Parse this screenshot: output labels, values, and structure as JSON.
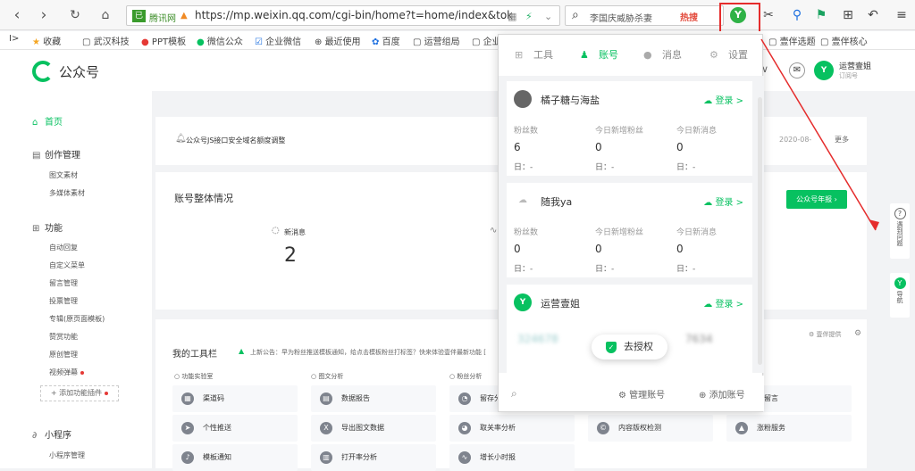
{
  "browser": {
    "site_badge": "已",
    "site_name": "腾讯网",
    "url": "https://mp.weixin.qq.com/cgi-bin/home?t=home/index&toke",
    "search_text": "李国庆威胁杀妻",
    "search_hot": "热搜",
    "ext_logo_letter": "Y"
  },
  "bookmarks": [
    "收藏",
    "武汉科技",
    "PPT模板",
    "微信公众",
    "企业微信",
    "最近使用",
    "百度",
    "运营组局",
    "企业",
    "壹伴选题",
    "壹伴核心"
  ],
  "topnav": {
    "logo_text": "公众号",
    "account_name": "运营壹姐",
    "account_sub": "订阅号",
    "avatar_letter": "Y"
  },
  "sidebar": {
    "home": "首页",
    "create": "创作管理",
    "create_items": [
      "图文素材",
      "多媒体素材"
    ],
    "func": "功能",
    "func_items": [
      "自动回复",
      "自定义菜单",
      "留言管理",
      "投票管理",
      "专辑(原页面模板)",
      "赞赏功能",
      "原创管理",
      "视频弹幕"
    ],
    "add_plugin": "+ 添加功能插件",
    "mini": "小程序",
    "mini_items": [
      "小程序管理"
    ]
  },
  "main": {
    "notice": "公众号JS接口安全域名额度调整",
    "notice_date": "2020-08-",
    "notice_more": "更多",
    "overview_title": "账号整体情况",
    "report_btn": "公众号年报",
    "metric_label": "新消息",
    "metric_value": "2",
    "toolbar_title": "我的工具栏",
    "toolbar_notice": "上新公告：早为粉丝推送模板通知，给点击模板粉丝打标签？快来体验壹伴最新功能 [",
    "brand_tag": "壹伴提供",
    "categories": [
      "功能实验室",
      "图文分析",
      "粉丝分析"
    ],
    "tools": [
      "渠道码",
      "数据报告",
      "留存分析",
      "个性推送",
      "导出图文数据",
      "取关率分析",
      "内容版权检测",
      "涨粉服务",
      "模板通知",
      "打开率分析",
      "增长小时报",
      "增留言"
    ]
  },
  "side_float": [
    {
      "icon": "?",
      "label": "遇到问题"
    },
    {
      "icon": "Y",
      "label": "导航"
    }
  ],
  "popup": {
    "tabs": [
      "工具",
      "账号",
      "消息",
      "设置"
    ],
    "active_tab": "账号",
    "login_label": "登录 >",
    "stat_labels": [
      "粉丝数",
      "今日新增粉丝",
      "今日新消息"
    ],
    "day_label": "日：-",
    "accounts": [
      {
        "name": "橘子糖与海盐",
        "stats": [
          "6",
          "0",
          "0"
        ]
      },
      {
        "name": "随我ya",
        "stats": [
          "0",
          "0",
          "0"
        ]
      },
      {
        "name": "运营壹姐",
        "stats": [
          "324678",
          "7634"
        ]
      }
    ],
    "auth_button": "去授权",
    "manage_label": "管理账号",
    "add_label": "添加账号"
  }
}
